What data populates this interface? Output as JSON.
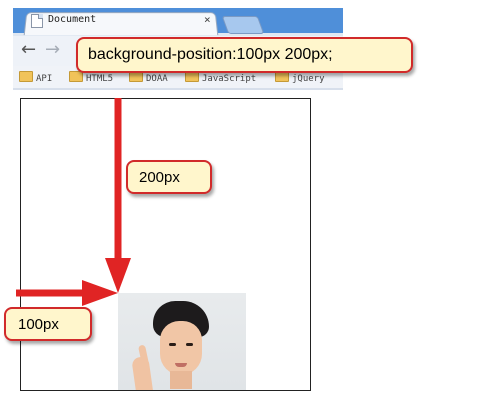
{
  "browser": {
    "tab_title": "Document",
    "tab_close": "×",
    "nav_back": "←",
    "nav_forward": "→",
    "bookmarks": [
      "API",
      "HTML5",
      "DOAA",
      "JavaScript",
      "jQuery"
    ]
  },
  "annotations": {
    "main_callout": "background-position:100px 200px;",
    "vertical_callout": "200px",
    "horizontal_callout": "100px"
  },
  "colors": {
    "arrow": "#e02424",
    "callout_fill": "#fff6cc",
    "callout_border": "#d12a2a",
    "tab_bar": "#4f8fd9"
  },
  "icons": [
    "document-icon",
    "folder-icon",
    "back-arrow-icon",
    "forward-arrow-icon",
    "close-icon"
  ]
}
